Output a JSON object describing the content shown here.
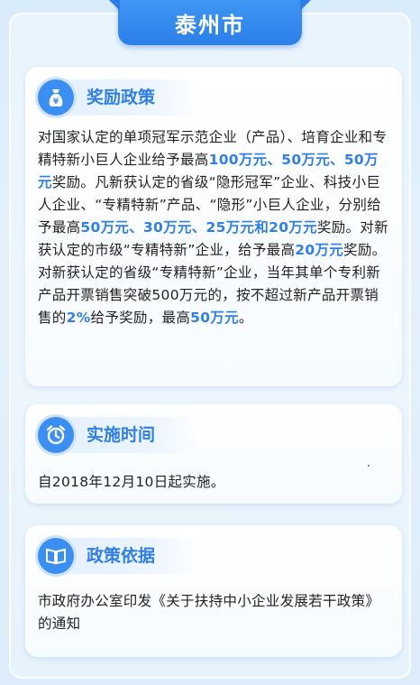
{
  "header": {
    "title": "泰州市"
  },
  "sections": [
    {
      "label": "奖励政策",
      "icon": "money-bag-icon",
      "segments": [
        {
          "t": "对国家认定的单项冠军示范企业（产品）、培育企业和专精特新小巨人企业给予最高",
          "hl": false
        },
        {
          "t": "100万元、50万元、50万元",
          "hl": true
        },
        {
          "t": "奖励。凡新获认定的省级“隐形冠军”企业、科技小巨人企业、“专精特新”产品、“隐形”小巨人企业，分别给予最高",
          "hl": false
        },
        {
          "t": "50万元、30万元、25万元和20万元",
          "hl": true
        },
        {
          "t": "奖励。对新获认定的市级“专精特新”企业，给予最高",
          "hl": false
        },
        {
          "t": "20万元",
          "hl": true
        },
        {
          "t": "奖励。对新获认定的省级“专精特新”企业，当年其单个专利新产品开票销售突破500万元的，按不超过新产品开票销售的",
          "hl": false
        },
        {
          "t": "2%",
          "hl": true
        },
        {
          "t": "给予奖励，最高",
          "hl": false
        },
        {
          "t": "50万元",
          "hl": true
        },
        {
          "t": "。",
          "hl": false
        }
      ]
    },
    {
      "label": "实施时间",
      "icon": "alarm-clock-icon",
      "segments": [
        {
          "t": "自2018年12月10日起实施。",
          "hl": false
        }
      ]
    },
    {
      "label": "政策依据",
      "icon": "open-book-icon",
      "segments": [
        {
          "t": "市政府办公室印发《关于扶持中小企业发展若干政策》的通知",
          "hl": false
        }
      ]
    }
  ],
  "colors": {
    "accent": "#2f7fe5",
    "header_bg": "#2c7fe8",
    "text": "#222222"
  }
}
